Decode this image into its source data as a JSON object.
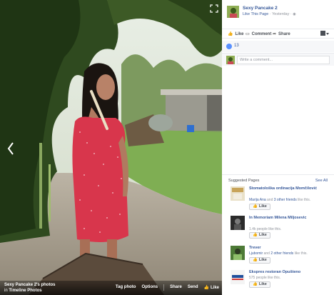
{
  "photo": {
    "album_title": "Sexy Pancake 2's photos",
    "album_location_prefix": "in",
    "album_location": "Timeline Photos",
    "actions": {
      "tag_photo": "Tag photo",
      "options": "Options",
      "share": "Share",
      "send": "Send",
      "like": "Like"
    },
    "icons": {
      "prev": "chevron-left-icon",
      "fullscreen": "fullscreen-icon",
      "like": "thumbs-up-icon"
    }
  },
  "post": {
    "page_name": "Sexy Pancake 2",
    "like_page": "Like This Page",
    "separator": "·",
    "time": "Yesterday",
    "privacy_icon": "globe-icon",
    "actions": {
      "like": "Like",
      "comment": "Comment",
      "share": "Share"
    },
    "reaction_count": "13",
    "comment_placeholder": "Write a comment..."
  },
  "suggested": {
    "heading": "Suggested Pages",
    "see_all": "See All",
    "like_label": "Like",
    "items": [
      {
        "name": "Stomatološka ordinacija Momčilović",
        "friend": "Marija Ana",
        "rest": " and ",
        "others": "3 other friends",
        "tail": " like this."
      },
      {
        "name": "In Memoriam Milena Miljosevic",
        "plain": "1.4k people like this."
      },
      {
        "name": "Trever",
        "friend": "Ljubomir",
        "rest": " and ",
        "others": "2 other friends",
        "tail": " like this."
      },
      {
        "name": "Ekspres restoran Opušteno",
        "plain": "575 people like this."
      }
    ]
  },
  "colors": {
    "link": "#365899",
    "muted": "#90949c",
    "panel_bg": "#f6f7f9",
    "reaction_blue": "#5890ff",
    "dress_red": "#d8364c"
  }
}
